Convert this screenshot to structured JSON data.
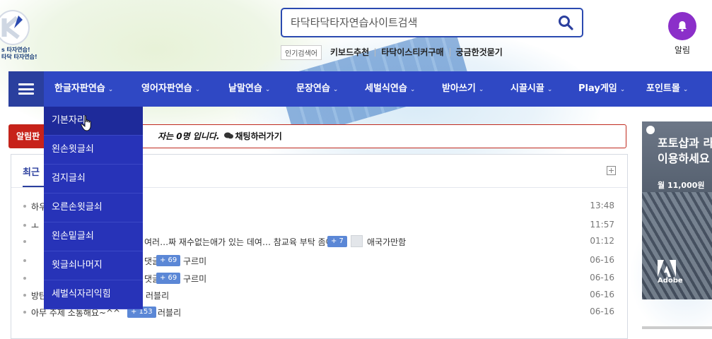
{
  "logo": {
    "text_line1": "s 타자연습!",
    "text_line2": "타닥 타자연습!"
  },
  "search": {
    "placeholder": "타닥타닥타자연습사이트검색"
  },
  "popular": {
    "label": "인기검색어",
    "links": [
      "키보드추천",
      "타닥이스티커구매",
      "궁금한것묻기"
    ]
  },
  "alarm": {
    "label": "알림"
  },
  "nav": {
    "items": [
      "한글자판연습",
      "영어자판연습",
      "낱말연습",
      "문장연습",
      "세벌식연습",
      "받아쓰기",
      "시끌시끌",
      "Play게임",
      "포인트몰"
    ],
    "caret": "⌄"
  },
  "dropdown": {
    "items": [
      "기본자리",
      "왼손윗글쇠",
      "검지글쇠",
      "오른손윗글쇠",
      "왼손밑글쇠",
      "윗글쇠나머지",
      "세벌식자리익힘"
    ]
  },
  "notice": {
    "tag": "알림판",
    "text": "자는 0명 입니다.",
    "chat_link": "채팅하러가기"
  },
  "board": {
    "tab": "최근",
    "rows": [
      {
        "title": "하우",
        "time": "13:48"
      },
      {
        "title": "ㅗ",
        "time": "11:57"
      },
      {
        "title": "여러…짜 재수없는애가 있는 데여… 참교육 부탁 좀여!",
        "count": "+ 7",
        "author": "애국가만함",
        "time": "01:12"
      },
      {
        "title": "댓글…요!",
        "count": "+ 69",
        "author": "구르미",
        "time": "06-16"
      },
      {
        "title": "댓글…요!",
        "count": "+ 69",
        "author": "구르미",
        "time": "06-16"
      },
      {
        "title": "방탄…",
        "author": "러블리",
        "time": "06-16"
      },
      {
        "title": "아무 주제 소통해요~^^",
        "count": "+ 153",
        "author": "러블리",
        "time": "06-16"
      }
    ]
  },
  "ad": {
    "title_line1": "포토샵과 라",
    "title_line2": "이용하세요",
    "price": "월 11,000원",
    "brand": "Adobe"
  },
  "colors": {
    "nav_bg": "#2f48c4",
    "dropdown_bg": "#2733b8",
    "notice_red": "#c7221a",
    "alarm_purple": "#8b2fc9",
    "count_badge": "#5b87d6"
  }
}
